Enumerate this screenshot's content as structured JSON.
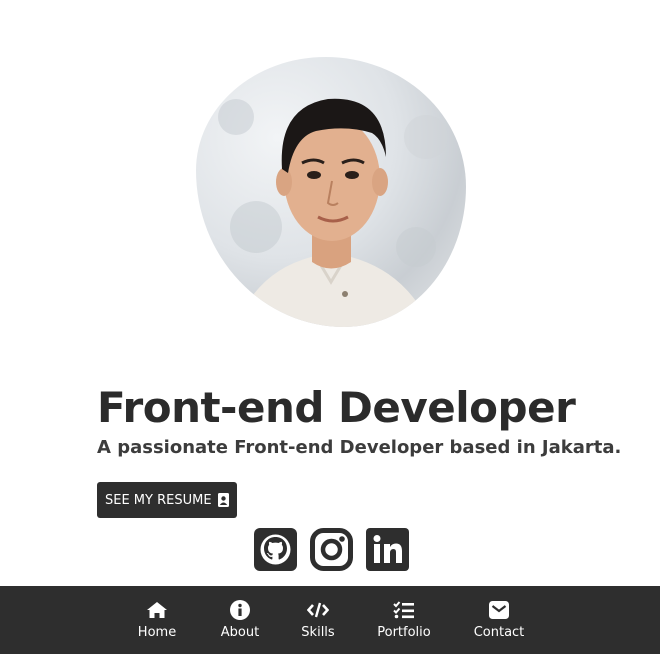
{
  "hero": {
    "title": "Front-end Developer",
    "subtitle": "A passionate Front-end Developer based in Jakarta.",
    "resume_button": "SEE MY RESUME"
  },
  "avatar": {
    "icon": "profile-photo"
  },
  "socials": [
    {
      "name": "github-icon"
    },
    {
      "name": "instagram-icon"
    },
    {
      "name": "linkedin-icon"
    }
  ],
  "nav": {
    "items": [
      {
        "label": "Home",
        "icon": "home-icon"
      },
      {
        "label": "About",
        "icon": "info-icon"
      },
      {
        "label": "Skills",
        "icon": "code-icon"
      },
      {
        "label": "Portfolio",
        "icon": "list-check-icon"
      },
      {
        "label": "Contact",
        "icon": "envelope-icon"
      }
    ]
  },
  "colors": {
    "text": "#2b2b2b",
    "dark": "#2e2e2e",
    "background": "#ffffff"
  }
}
